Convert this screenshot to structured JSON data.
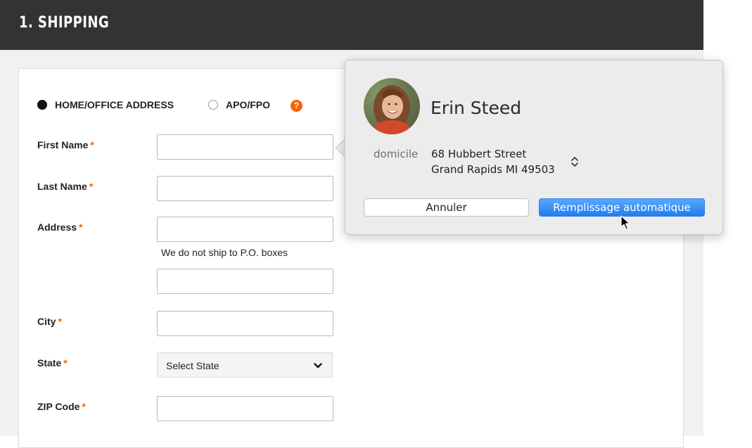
{
  "header": {
    "title": "1. SHIPPING"
  },
  "address_type": {
    "options": [
      {
        "label": "HOME/OFFICE ADDRESS",
        "selected": true
      },
      {
        "label": "APO/FPO",
        "selected": false
      }
    ],
    "help_icon": "?"
  },
  "form": {
    "required_marker": "*",
    "first_name": {
      "label": "First Name",
      "value": ""
    },
    "last_name": {
      "label": "Last Name",
      "value": ""
    },
    "address": {
      "label": "Address",
      "value": "",
      "line2_value": "",
      "hint": "We do not ship to P.O. boxes"
    },
    "city": {
      "label": "City",
      "value": ""
    },
    "state": {
      "label": "State",
      "selected": "Select State"
    },
    "zip": {
      "label": "ZIP Code",
      "value": ""
    }
  },
  "autofill_popover": {
    "contact_name": "Erin Steed",
    "address_type": "domicile",
    "address_lines": [
      "68 Hubbert Street",
      "Grand Rapids MI 49503"
    ],
    "cancel_label": "Annuler",
    "autofill_label": "Remplissage automatique"
  },
  "colors": {
    "header_bg": "#333333",
    "accent_orange": "#f96302",
    "autofill_blue": "#1f7df3"
  },
  "icons": {
    "help": "question-mark-icon",
    "select_chevron": "chevron-down-icon",
    "address_stepper": "up-down-chevron-icon",
    "pointer": "mouse-cursor-icon"
  }
}
